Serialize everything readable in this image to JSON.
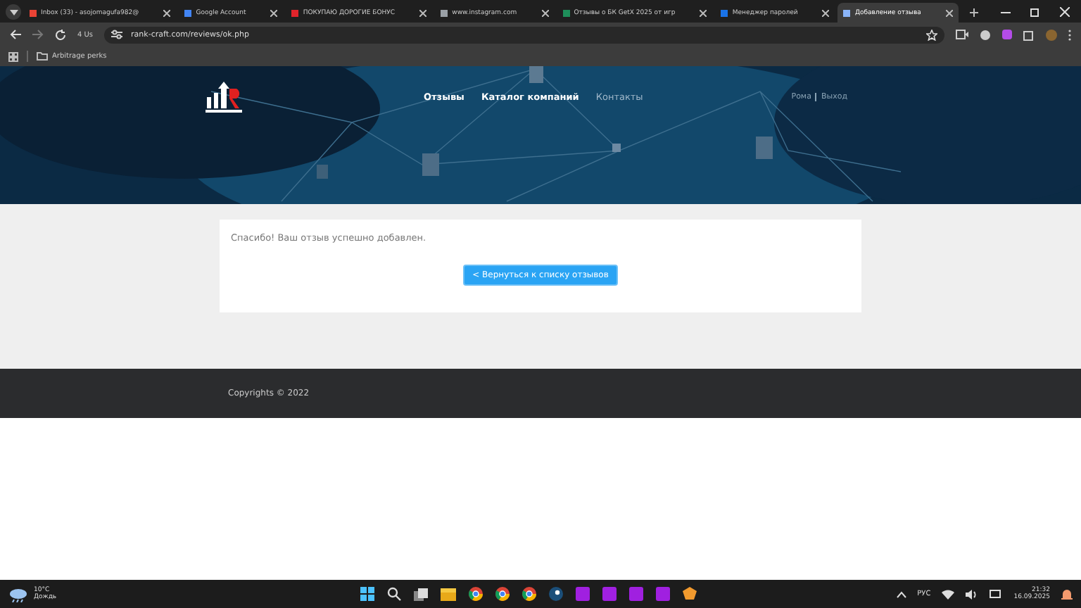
{
  "browser": {
    "tabs": [
      {
        "title": "Inbox (33) - asojomagufa982@",
        "selected": false
      },
      {
        "title": "Google Account",
        "selected": false
      },
      {
        "title": "ПОКУПАЮ ДОРОГИЕ БОНУС",
        "selected": false
      },
      {
        "title": "www.instagram.com",
        "selected": false
      },
      {
        "title": "Отзывы о БК GetX 2025 от игр",
        "selected": false
      },
      {
        "title": "Менеджер паролей",
        "selected": false
      },
      {
        "title": "Добавление отзыва",
        "selected": true
      }
    ],
    "chip": "4 Us",
    "url": "rank-craft.com/reviews/ok.php",
    "bookmarks": [
      "Arbitrage perks"
    ]
  },
  "site": {
    "nav": [
      {
        "label": "Отзывы",
        "muted": false
      },
      {
        "label": "Каталог компаний",
        "muted": false
      },
      {
        "label": "Контакты",
        "muted": true
      }
    ],
    "user": "Рома",
    "logout": "Выход",
    "message": "Спасибо! Ваш отзыв успешно добавлен.",
    "back_button": "< Вернуться к списку отзывов",
    "footer": "Copyrights © 2022"
  },
  "taskbar": {
    "temperature": "10°C",
    "weather": "Дождь",
    "language": "РУС",
    "time": "21:32",
    "date": "16.09.2025"
  }
}
